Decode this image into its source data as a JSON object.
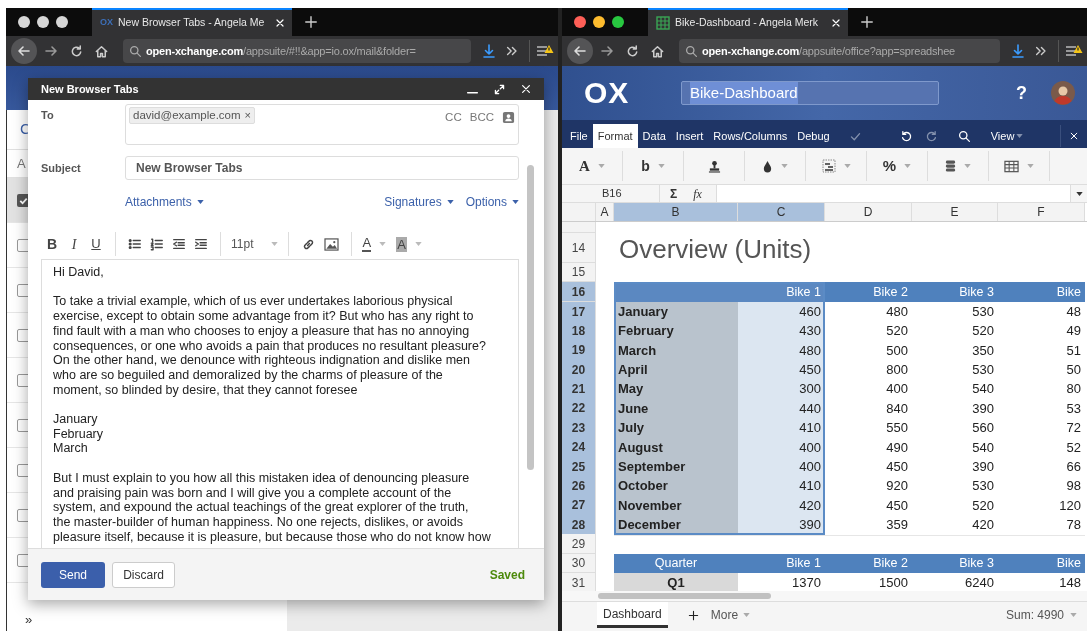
{
  "mail_window": {
    "browser": {
      "focused": false,
      "favicon": "OX",
      "tab_title": "New Browser Tabs - Angela Me",
      "url_host": "open-xchange.com",
      "url_path": "/appsuite/#!!&app=io.ox/mail&folder="
    },
    "background": {
      "toolbar_text": "C",
      "header_text": "A",
      "items": [
        {
          "checked": true,
          "selected": true
        },
        {
          "checked": false,
          "selected": false
        },
        {
          "checked": false,
          "selected": false
        },
        {
          "checked": false,
          "selected": false
        },
        {
          "checked": false,
          "selected": false
        },
        {
          "checked": false,
          "selected": false
        },
        {
          "checked": false,
          "selected": false
        },
        {
          "checked": false,
          "selected": false
        },
        {
          "checked": false,
          "selected": false
        }
      ],
      "footer_toggle": "»"
    },
    "compose": {
      "title": "New Browser Tabs",
      "to": {
        "label": "To",
        "recipients": [
          {
            "address": "david@example.com",
            "remove": "×"
          }
        ],
        "cc": "CC",
        "bcc": "BCC"
      },
      "subject": {
        "label": "Subject",
        "value": "New Browser Tabs"
      },
      "links_left": [
        "Attachments"
      ],
      "links_right": [
        "Signatures",
        "Options"
      ],
      "toolbar": [
        {
          "kind": "bold",
          "text": "B"
        },
        {
          "kind": "italic",
          "text": "I"
        },
        {
          "kind": "underline",
          "text": "U"
        },
        {
          "kind": "separator"
        },
        {
          "kind": "bullets"
        },
        {
          "kind": "numbers"
        },
        {
          "kind": "outdent"
        },
        {
          "kind": "indent"
        },
        {
          "kind": "separator"
        },
        {
          "kind": "size",
          "text": "11pt",
          "dropdown": true
        },
        {
          "kind": "separator"
        },
        {
          "kind": "link"
        },
        {
          "kind": "image"
        },
        {
          "kind": "separator"
        },
        {
          "kind": "color",
          "text": "A",
          "dropdown": true
        },
        {
          "kind": "highlight",
          "text": "A",
          "dropdown": true
        }
      ],
      "body": [
        [
          "Hi David,"
        ],
        [
          "To take a trivial example, which of us ever undertakes laborious physical",
          "exercise, except to obtain some advantage from it? But who has any right to",
          "find fault with a man who chooses to enjoy a pleasure that has no annoying",
          "consequences, or one who avoids a pain that produces no resultant pleasure?",
          "On the other hand, we denounce with righteous indignation and dislike men",
          "who are so beguiled and demoralized by the charms of pleasure of the",
          "moment, so blinded by desire, that they cannot foresee"
        ],
        [
          "January",
          "February",
          "March"
        ],
        [
          "But I must explain to you how all this mistaken idea of denouncing pleasure",
          "and praising pain was born and I will give you a complete account of the",
          "system, and expound the actual teachings of the great explorer of the truth,",
          "the master-builder of human happiness. No one rejects, dislikes, or avoids",
          "pleasure itself, because it is pleasure, but because those who do not know how"
        ]
      ],
      "send": "Send",
      "discard": "Discard",
      "status": "Saved"
    }
  },
  "sheet_window": {
    "browser": {
      "focused": true,
      "tab_title": "Bike-Dashboard - Angela Merk",
      "url_host": "open-xchange.com",
      "url_path": "/appsuite/office?app=spreadshee"
    },
    "app_bar": {
      "logo": "OX",
      "document_name": "Bike-Dashboard",
      "name_selected": true,
      "help": "?"
    },
    "menu": {
      "tabs": [
        {
          "label": "File",
          "selected": false
        },
        {
          "label": "Format",
          "selected": true
        },
        {
          "label": "Data",
          "selected": false
        },
        {
          "label": "Insert",
          "selected": false
        },
        {
          "label": "Rows/Columns",
          "selected": false
        },
        {
          "label": "Debug",
          "selected": false
        }
      ],
      "actions": [
        {
          "kind": "check",
          "disabled": true
        },
        {
          "kind": "undo",
          "disabled": false
        },
        {
          "kind": "redo",
          "disabled": true
        },
        {
          "kind": "search",
          "disabled": false
        }
      ],
      "view": "View"
    },
    "toolbar": [
      {
        "kind": "font",
        "text": "A",
        "dropdown": true
      },
      {
        "kind": "bold",
        "text": "b",
        "dropdown": true
      },
      {
        "kind": "stamp",
        "dropdown": false
      },
      {
        "kind": "fill",
        "dropdown": true
      },
      {
        "kind": "borders",
        "dropdown": true
      },
      {
        "kind": "percent",
        "text": "%",
        "dropdown": true
      },
      {
        "kind": "cellstyle",
        "dropdown": true
      },
      {
        "kind": "table",
        "dropdown": true
      }
    ],
    "formula_bar": {
      "cell_name": "B16",
      "sum_symbol": "Σ",
      "function_symbol": "fx"
    },
    "columns": [
      {
        "label": "A",
        "selected": false
      },
      {
        "label": "B",
        "selected": true
      },
      {
        "label": "C",
        "selected": true
      },
      {
        "label": "D",
        "selected": false
      },
      {
        "label": "E",
        "selected": false
      },
      {
        "label": "F",
        "selected": false
      }
    ],
    "rows": [
      {
        "number": "14",
        "selected": false,
        "kind": "title",
        "text": "Overview (Units)"
      },
      {
        "number": "15",
        "selected": false,
        "kind": "blank"
      },
      {
        "number": "16",
        "selected": true,
        "kind": "header",
        "values": [
          "Bike 1",
          "Bike 2",
          "Bike 3",
          "Bike"
        ]
      },
      {
        "number": "17",
        "selected": true,
        "kind": "data",
        "label": "January",
        "values": [
          "460",
          "480",
          "530",
          "48"
        ]
      },
      {
        "number": "18",
        "selected": true,
        "kind": "data",
        "label": "February",
        "values": [
          "430",
          "520",
          "520",
          "49"
        ]
      },
      {
        "number": "19",
        "selected": true,
        "kind": "data",
        "label": "March",
        "values": [
          "480",
          "500",
          "350",
          "51"
        ]
      },
      {
        "number": "20",
        "selected": true,
        "kind": "data",
        "label": "April",
        "values": [
          "450",
          "800",
          "530",
          "50"
        ]
      },
      {
        "number": "21",
        "selected": true,
        "kind": "data",
        "label": "May",
        "values": [
          "300",
          "400",
          "540",
          "80"
        ]
      },
      {
        "number": "22",
        "selected": true,
        "kind": "data",
        "label": "June",
        "values": [
          "440",
          "840",
          "390",
          "53"
        ]
      },
      {
        "number": "23",
        "selected": true,
        "kind": "data",
        "label": "July",
        "values": [
          "410",
          "550",
          "560",
          "72"
        ]
      },
      {
        "number": "24",
        "selected": true,
        "kind": "data",
        "label": "August",
        "values": [
          "400",
          "490",
          "540",
          "52"
        ]
      },
      {
        "number": "25",
        "selected": true,
        "kind": "data",
        "label": "September",
        "values": [
          "400",
          "450",
          "390",
          "66"
        ]
      },
      {
        "number": "26",
        "selected": true,
        "kind": "data",
        "label": "October",
        "values": [
          "410",
          "920",
          "530",
          "98"
        ]
      },
      {
        "number": "27",
        "selected": true,
        "kind": "data",
        "label": "November",
        "values": [
          "420",
          "450",
          "520",
          "120"
        ]
      },
      {
        "number": "28",
        "selected": true,
        "kind": "data",
        "label": "December",
        "values": [
          "390",
          "359",
          "420",
          "78"
        ]
      },
      {
        "number": "29",
        "selected": false,
        "kind": "blank"
      },
      {
        "number": "30",
        "selected": false,
        "kind": "header",
        "label": "Quarter",
        "values": [
          "Bike 1",
          "Bike 2",
          "Bike 3",
          "Bike"
        ]
      },
      {
        "number": "31",
        "selected": false,
        "kind": "summary",
        "label": "Q1",
        "values": [
          "1370",
          "1500",
          "6240",
          "148"
        ]
      }
    ],
    "sheet_tabs": [
      {
        "label": "Dashboard",
        "selected": true
      }
    ],
    "more": "More",
    "status": "Sum: 4990"
  }
}
